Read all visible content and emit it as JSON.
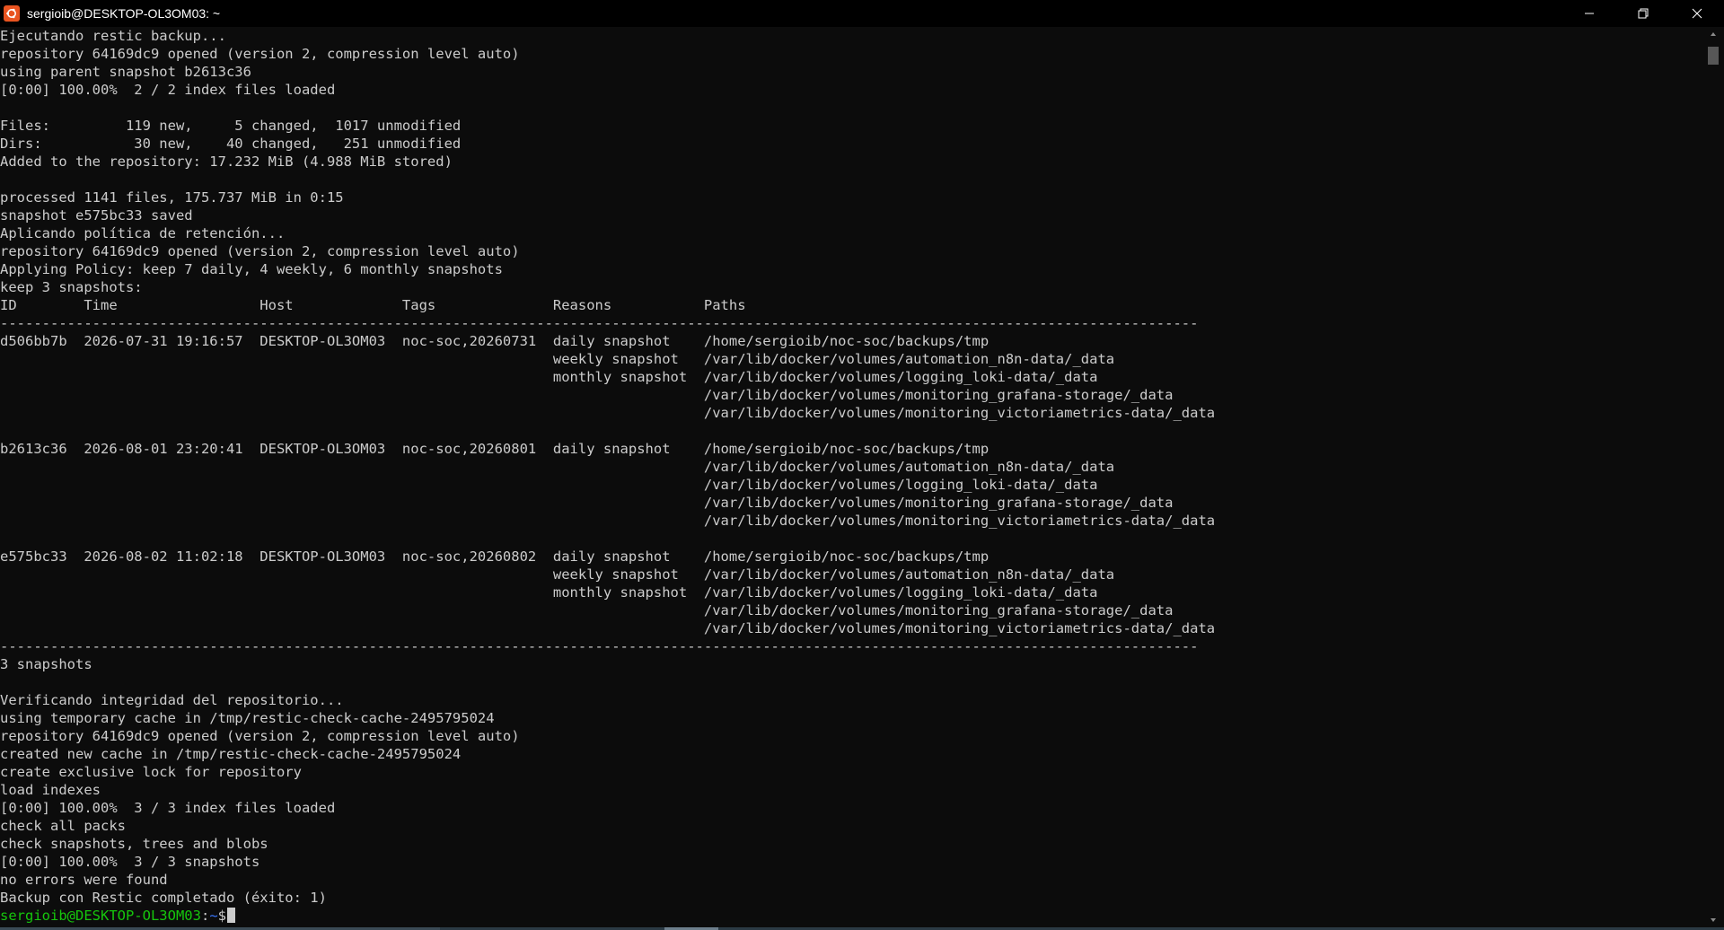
{
  "window": {
    "title": "sergioib@DESKTOP-OL3OM03: ~",
    "icon": "ubuntu-terminal-icon",
    "controls": [
      "minimize-icon",
      "restore-icon",
      "close-icon"
    ]
  },
  "colors": {
    "background": "#0c0c0c",
    "text": "#cccccc",
    "prompt_user": "#16c60c",
    "prompt_path": "#3b78ff",
    "app_icon": "#e95420"
  },
  "terminal": {
    "lines": [
      "Ejecutando restic backup...",
      "repository 64169dc9 opened (version 2, compression level auto)",
      "using parent snapshot b2613c36",
      "[0:00] 100.00%  2 / 2 index files loaded",
      "",
      "Files:         119 new,     5 changed,  1017 unmodified",
      "Dirs:           30 new,    40 changed,   251 unmodified",
      "Added to the repository: 17.232 MiB (4.988 MiB stored)",
      "",
      "processed 1141 files, 175.737 MiB in 0:15",
      "snapshot e575bc33 saved",
      "Aplicando política de retención...",
      "repository 64169dc9 opened (version 2, compression level auto)",
      "Applying Policy: keep 7 daily, 4 weekly, 6 monthly snapshots",
      "keep 3 snapshots:",
      "ID        Time                 Host             Tags              Reasons           Paths",
      "-----------------------------------------------------------------------------------------------------------------------------------------------",
      "d506bb7b  2026-07-31 19:16:57  DESKTOP-OL3OM03  noc-soc,20260731  daily snapshot    /home/sergioib/noc-soc/backups/tmp",
      "                                                                  weekly snapshot   /var/lib/docker/volumes/automation_n8n-data/_data",
      "                                                                  monthly snapshot  /var/lib/docker/volumes/logging_loki-data/_data",
      "                                                                                    /var/lib/docker/volumes/monitoring_grafana-storage/_data",
      "                                                                                    /var/lib/docker/volumes/monitoring_victoriametrics-data/_data",
      "",
      "b2613c36  2026-08-01 23:20:41  DESKTOP-OL3OM03  noc-soc,20260801  daily snapshot    /home/sergioib/noc-soc/backups/tmp",
      "                                                                                    /var/lib/docker/volumes/automation_n8n-data/_data",
      "                                                                                    /var/lib/docker/volumes/logging_loki-data/_data",
      "                                                                                    /var/lib/docker/volumes/monitoring_grafana-storage/_data",
      "                                                                                    /var/lib/docker/volumes/monitoring_victoriametrics-data/_data",
      "",
      "e575bc33  2026-08-02 11:02:18  DESKTOP-OL3OM03  noc-soc,20260802  daily snapshot    /home/sergioib/noc-soc/backups/tmp",
      "                                                                  weekly snapshot   /var/lib/docker/volumes/automation_n8n-data/_data",
      "                                                                  monthly snapshot  /var/lib/docker/volumes/logging_loki-data/_data",
      "                                                                                    /var/lib/docker/volumes/monitoring_grafana-storage/_data",
      "                                                                                    /var/lib/docker/volumes/monitoring_victoriametrics-data/_data",
      "-----------------------------------------------------------------------------------------------------------------------------------------------",
      "3 snapshots",
      "",
      "Verificando integridad del repositorio...",
      "using temporary cache in /tmp/restic-check-cache-2495795024",
      "repository 64169dc9 opened (version 2, compression level auto)",
      "created new cache in /tmp/restic-check-cache-2495795024",
      "create exclusive lock for repository",
      "load indexes",
      "[0:00] 100.00%  3 / 3 index files loaded",
      "check all packs",
      "check snapshots, trees and blobs",
      "[0:00] 100.00%  3 / 3 snapshots",
      "no errors were found",
      "Backup con Restic completado (éxito: 1)"
    ],
    "prompt": {
      "user_host": "sergioib@DESKTOP-OL3OM03",
      "separator": ":",
      "path": "~",
      "sign": "$"
    }
  }
}
